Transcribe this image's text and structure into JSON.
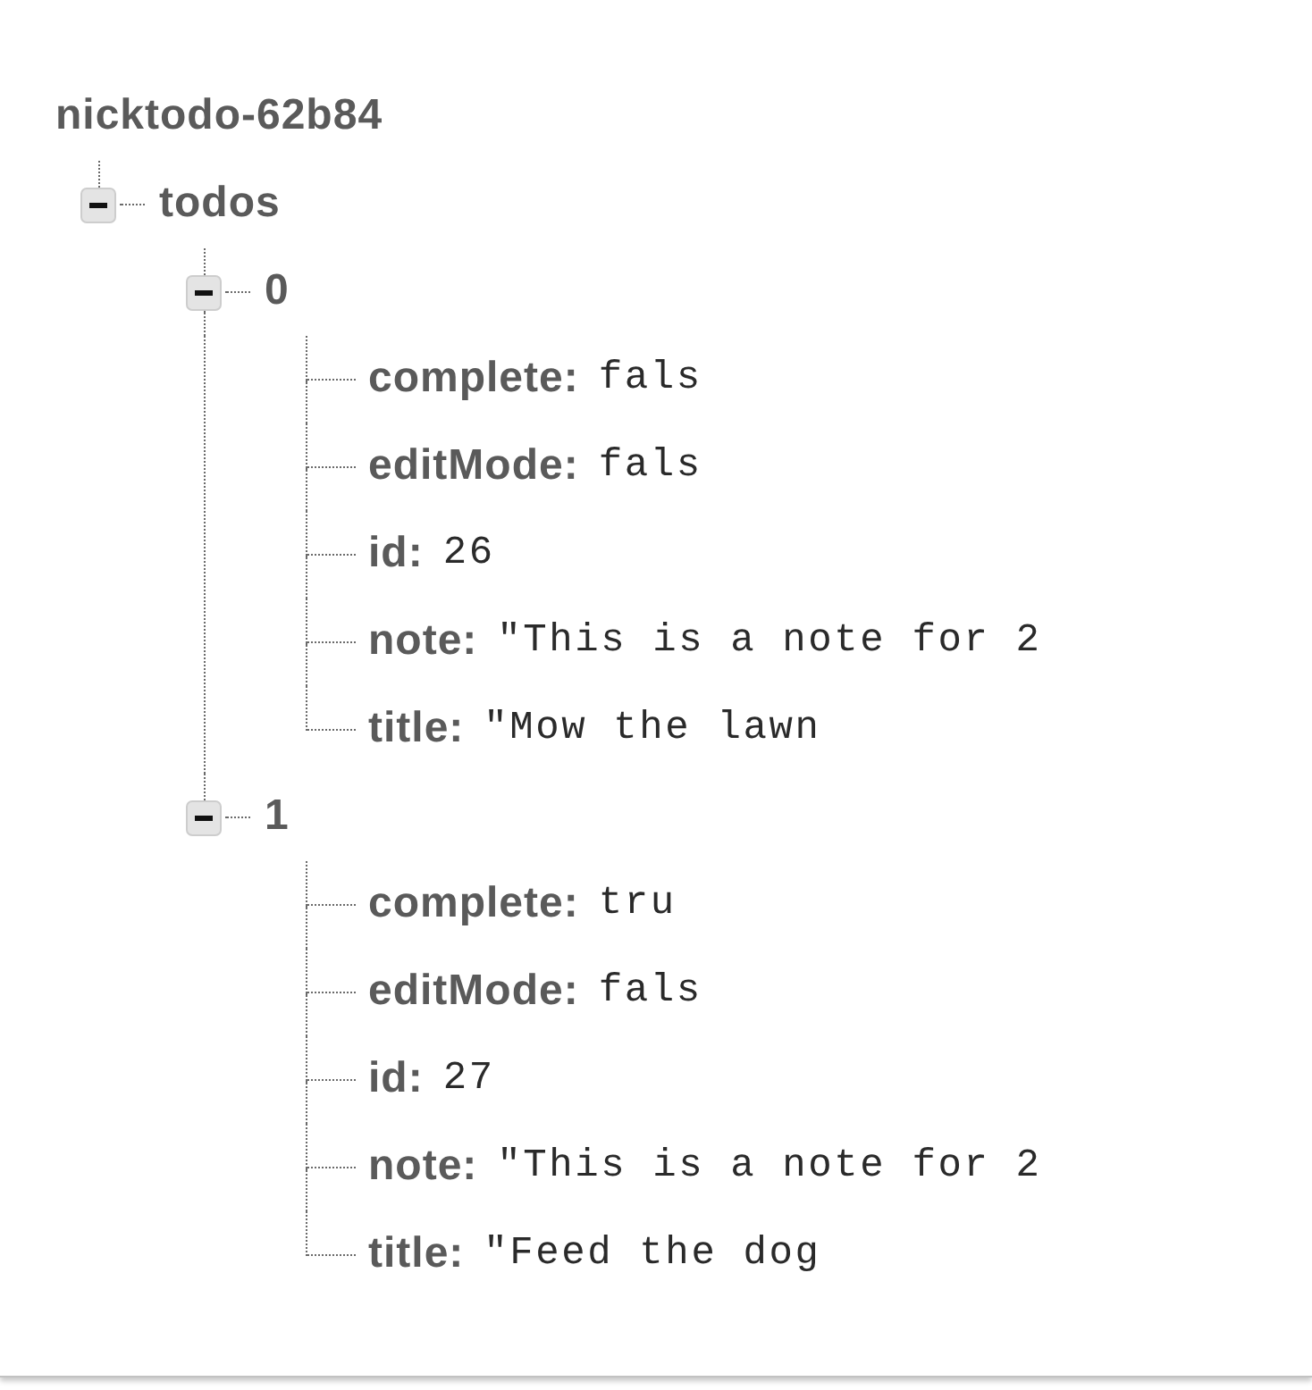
{
  "tree": {
    "root": "nicktodo-62b84",
    "children": [
      {
        "kind": "node",
        "key": "todos",
        "expanded": true,
        "children": [
          {
            "kind": "node",
            "key": "0",
            "expanded": true,
            "children": [
              {
                "kind": "leaf",
                "key": "complete:",
                "value": "fals"
              },
              {
                "kind": "leaf",
                "key": "editMode:",
                "value": "fals"
              },
              {
                "kind": "leaf",
                "key": "id:",
                "value": "26"
              },
              {
                "kind": "leaf",
                "key": "note:",
                "value": "\"This is a note for 2"
              },
              {
                "kind": "leaf",
                "key": "title:",
                "value": "\"Mow the lawn"
              }
            ]
          },
          {
            "kind": "node",
            "key": "1",
            "expanded": true,
            "children": [
              {
                "kind": "leaf",
                "key": "complete:",
                "value": "tru"
              },
              {
                "kind": "leaf",
                "key": "editMode:",
                "value": "fals"
              },
              {
                "kind": "leaf",
                "key": "id:",
                "value": "27"
              },
              {
                "kind": "leaf",
                "key": "note:",
                "value": "\"This is a note for 2"
              },
              {
                "kind": "leaf",
                "key": "title:",
                "value": "\"Feed the dog"
              }
            ]
          }
        ]
      }
    ]
  }
}
